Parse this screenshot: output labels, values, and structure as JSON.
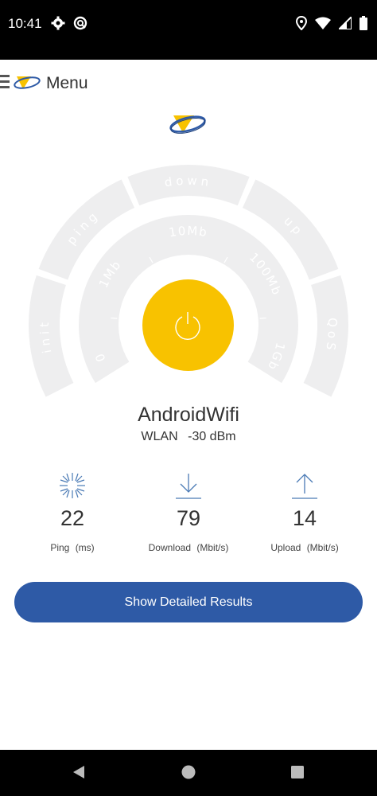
{
  "status_bar": {
    "time": "10:41",
    "icons": [
      "gear-icon",
      "sync-icon",
      "location-icon",
      "wifi-icon",
      "signal-icon",
      "battery-icon"
    ]
  },
  "header": {
    "menu_label": "Menu"
  },
  "gauge": {
    "outer_segments": [
      "init",
      "ping",
      "down",
      "up",
      "QoS"
    ],
    "inner_labels": [
      "0",
      "1Mb",
      "10Mb",
      "100Mb",
      "1Gb"
    ]
  },
  "network": {
    "name": "AndroidWifi",
    "type": "WLAN",
    "signal": "-30 dBm"
  },
  "metrics": {
    "ping": {
      "value": "22",
      "label": "Ping",
      "unit": "(ms)"
    },
    "download": {
      "value": "79",
      "label": "Download",
      "unit": "(Mbit/s)"
    },
    "upload": {
      "value": "14",
      "label": "Upload",
      "unit": "(Mbit/s)"
    }
  },
  "actions": {
    "details_button": "Show Detailed Results"
  },
  "colors": {
    "accent_yellow": "#f8c200",
    "button_blue": "#2e5aa6",
    "gauge_gray": "#eeeeef",
    "icon_blue": "#4a7ab5"
  }
}
